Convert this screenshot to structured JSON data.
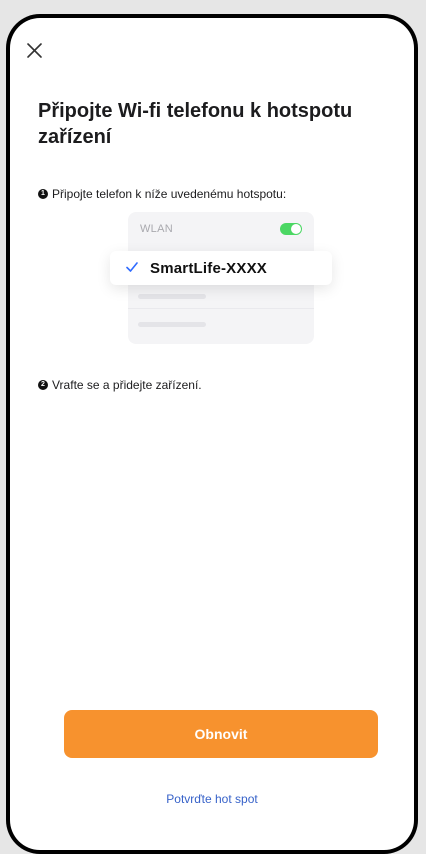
{
  "title": "Připojte Wi-fi telefonu k hotspotu zařízení",
  "steps": [
    {
      "number": "1",
      "text": "Připojte telefon k níže uvedenému hotspotu:"
    },
    {
      "number": "2",
      "text": "Vrafte se a přidejte zařízení."
    }
  ],
  "wlan_card": {
    "label": "WLAN",
    "toggle_on": true,
    "network_name": "SmartLife-XXXX"
  },
  "buttons": {
    "refresh_label": "Obnovit",
    "confirm_hotspot_label": "Potvrďte hot spot"
  },
  "colors": {
    "accent_orange": "#f7922e",
    "link_blue": "#3762c9",
    "toggle_green": "#4bd763",
    "check_blue": "#2f6bff"
  },
  "icons": {
    "close": "close-icon",
    "check": "check-icon"
  }
}
